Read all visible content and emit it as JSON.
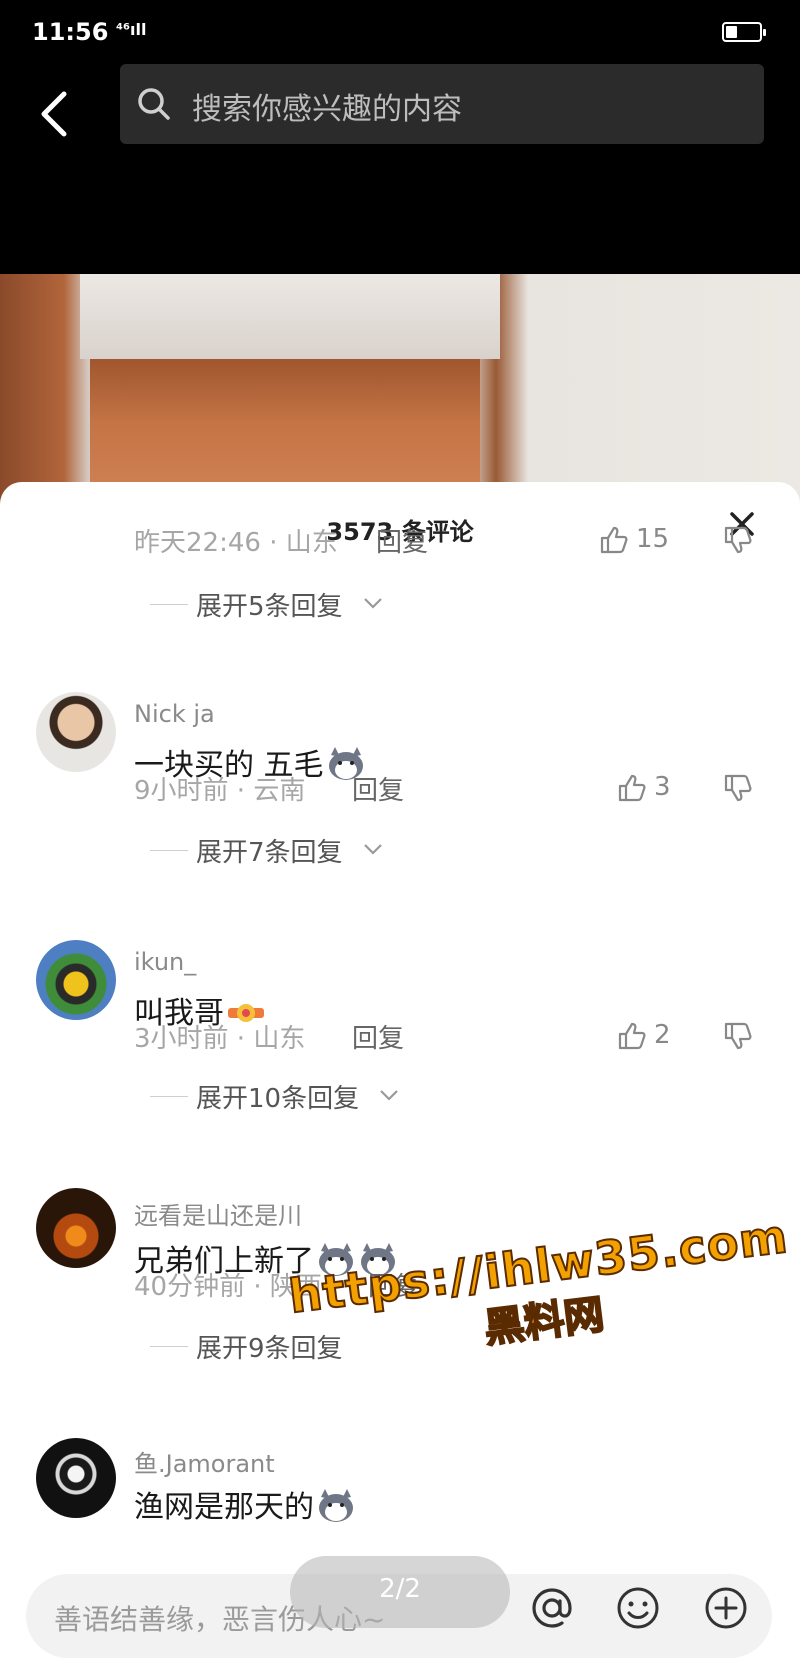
{
  "status_bar": {
    "time": "11:56",
    "signal": "⁴⁶ıll",
    "battery_level": 0.35
  },
  "header": {
    "search_placeholder": "搜索你感兴趣的内容"
  },
  "comments_panel": {
    "title": "3573 条评论",
    "comments": [
      {
        "meta": "昨天22:46 · 山东",
        "reply": "回复",
        "likes": "15",
        "expand": "展开5条回复"
      },
      {
        "username": "Nick ja",
        "text": "一块买的 五毛",
        "meta": "9小时前 · 云南",
        "reply": "回复",
        "likes": "3",
        "expand": "展开7条回复"
      },
      {
        "username": "ikun_",
        "text": "叫我哥",
        "meta": "3小时前 · 山东",
        "reply": "回复",
        "likes": "2",
        "expand": "展开10条回复"
      },
      {
        "username": "远看是山还是川",
        "text": "兄弟们上新了",
        "meta": "40分钟前 · 陕西",
        "reply": "回复",
        "likes": "",
        "expand": "展开9条回复"
      },
      {
        "username": "鱼.Jamorant",
        "text": "渔网是那天的",
        "meta": "",
        "reply": "",
        "likes": "",
        "expand": ""
      }
    ]
  },
  "watermark": {
    "url": "https://ihlw35.com",
    "name": "黑料网"
  },
  "pager": "2/2",
  "bottom_input": {
    "placeholder": "善语结善缘，恶言伤人心~"
  },
  "icons": {
    "back": "chevron-left-icon",
    "search": "search-icon",
    "close": "close-icon",
    "like": "thumbs-up-icon",
    "dislike": "thumbs-down-icon",
    "mention": "at-icon",
    "emoji": "smiley-icon",
    "add": "plus-circle-icon"
  },
  "colors": {
    "watermark": "#f2a100",
    "sheet": "#ffffff",
    "header": "#000000"
  }
}
